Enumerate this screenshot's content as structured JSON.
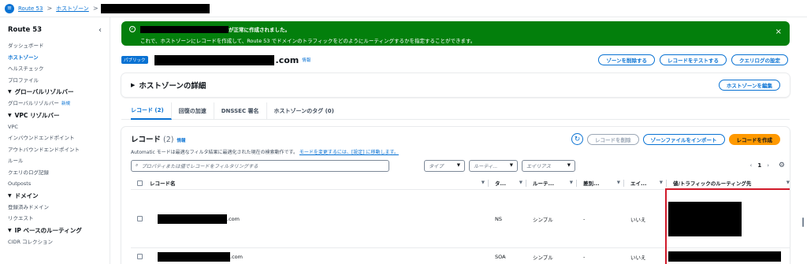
{
  "breadcrumb": {
    "root": "Route 53",
    "zones": "ホストゾーン",
    "sep": ">"
  },
  "sidebar": {
    "title": "Route 53",
    "items_top": [
      "ダッシュボード",
      "ホストゾーン",
      "ヘルスチェック",
      "プロファイル"
    ],
    "section_global": "グローバルリゾルバー",
    "global_item": "グローバルリゾルバー",
    "new_badge": "新規",
    "section_vpc": "VPC リゾルバー",
    "vpc_items": [
      "VPC",
      "インバウンドエンドポイント",
      "アウトバウンドエンドポイント",
      "ルール",
      "クエリのログ記録",
      "Outposts"
    ],
    "section_domain": "ドメイン",
    "domain_items": [
      "登録済みドメイン",
      "リクエスト"
    ],
    "section_ip": "IP ベースのルーティング",
    "ip_items": [
      "CIDR コレクション"
    ]
  },
  "flash": {
    "line1": "が正常に作成されました。",
    "line2": "これで、ホストゾーンにレコードを作成して、Route 53 でドメインのトラフィックをどのようにルーティングするかを指定することができます。",
    "close": "×"
  },
  "zone": {
    "badge": "パブリック",
    "suffix": ".com",
    "info": "情報",
    "buttons": [
      "ゾーンを削除する",
      "レコードをテストする",
      "クエリログの設定"
    ]
  },
  "details": {
    "title": "ホストゾーンの詳細",
    "edit": "ホストゾーンを編集"
  },
  "tabs": [
    "レコード (2)",
    "回復の加速",
    "DNSSEC 署名",
    "ホストゾーンのタグ (0)"
  ],
  "records": {
    "title": "レコード",
    "count": "(2)",
    "info": "情報",
    "delete": "レコードを削除",
    "import": "ゾーンファイルをインポート",
    "create": "レコードを作成",
    "desc_text": "Automatic モードは最適なフィルタ結果に最適化された現在の検索動作です。",
    "desc_link": "モードを変更するには、[設定] に移動します。",
    "search_placeholder": "プロパティまたは値でレコードをフィルタリングする",
    "filter_type": "タイプ",
    "filter_routing": "ルーティ...",
    "filter_alias": "エイリアス",
    "page": "1",
    "columns": [
      "レコード名",
      "タ...",
      "ルーテ...",
      "差別...",
      "エイ...",
      "値/トラフィックのルーティング先"
    ],
    "rows": [
      {
        "suffix": ".com",
        "type": "NS",
        "routing": "シンプル",
        "diff": "-",
        "alias": "いいえ"
      },
      {
        "suffix": ".com",
        "type": "SOA",
        "routing": "シンプル",
        "diff": "-",
        "alias": "いいえ"
      }
    ]
  },
  "colors": {
    "success": "#037f0c",
    "primary": "#0972d3",
    "accent": "#ff9900",
    "highlight": "#d11a2a"
  }
}
